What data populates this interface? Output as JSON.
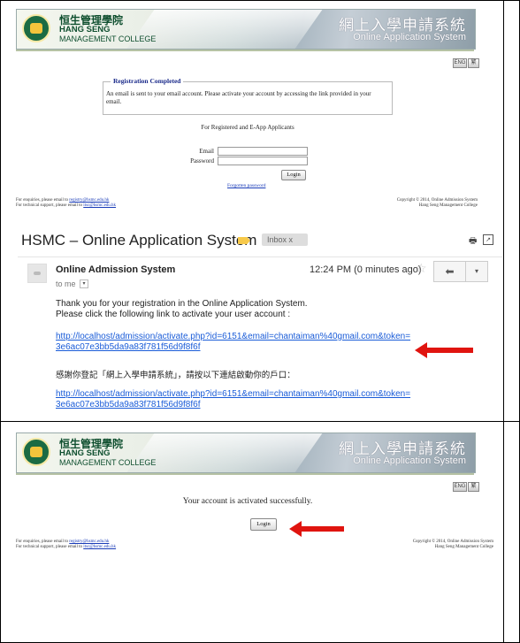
{
  "header": {
    "brand_cn": "恒生管理學院",
    "brand_en_line1": "HANG SENG",
    "brand_en_line2": "MANAGEMENT COLLEGE",
    "system_cn": "網上入學申請系統",
    "system_en": "Online Application System",
    "lang_buttons": [
      "ENG",
      "繁"
    ]
  },
  "registration": {
    "title": "Registration Completed",
    "message": "An email is sent to your email account. Please activate your account by accessing the link provided in your email.",
    "for_applicants": "For Registered and E-App Applicants",
    "email_label": "Email",
    "password_label": "Password",
    "login_label": "Login",
    "forgot_label": "Forgotten password"
  },
  "footer": {
    "enquiries_prefix": "For enquiries, please email to",
    "enquiries_email": "registry@hsmc.edu.hk",
    "technical_prefix": "For technical support, please email to",
    "technical_email": "itsc@hsmc.edu.hk",
    "copyright": "Copyright © 2014, Online Admission System",
    "college": "Hang Seng Management College"
  },
  "email": {
    "subject": "HSMC – Online Application System",
    "label_chip": "Inbox x",
    "sender": "Online Admission System",
    "to_me": "to me",
    "timestamp": "12:24 PM (0 minutes ago)",
    "line1": "Thank you for your registration in the Online Application System.",
    "line2": "Please click the following link to activate your user account :",
    "link_part1": "http://localhost/admission/activate.php?id=6151&email=chantaiman%40gmail.com&token=",
    "link_part2": "3e6ac07e3bb5da9a83f781f56d9f8f6f",
    "cn_line": "感謝你登記「網上入學申請系統」，請按以下連結啟動你的戶口：",
    "link2_part1": "http://localhost/admission/activate.php?id=6151&email=chantaiman%40gmail.com&token=",
    "link2_part2": "3e6ac07e3bb5da9a83f781f56d9f8f6f"
  },
  "activated": {
    "message": "Your account is activated successfully.",
    "login_label": "Login"
  },
  "colors": {
    "arrow": "#e0140f",
    "link": "#1a5cd8",
    "brand_green": "#0f4f2f"
  }
}
